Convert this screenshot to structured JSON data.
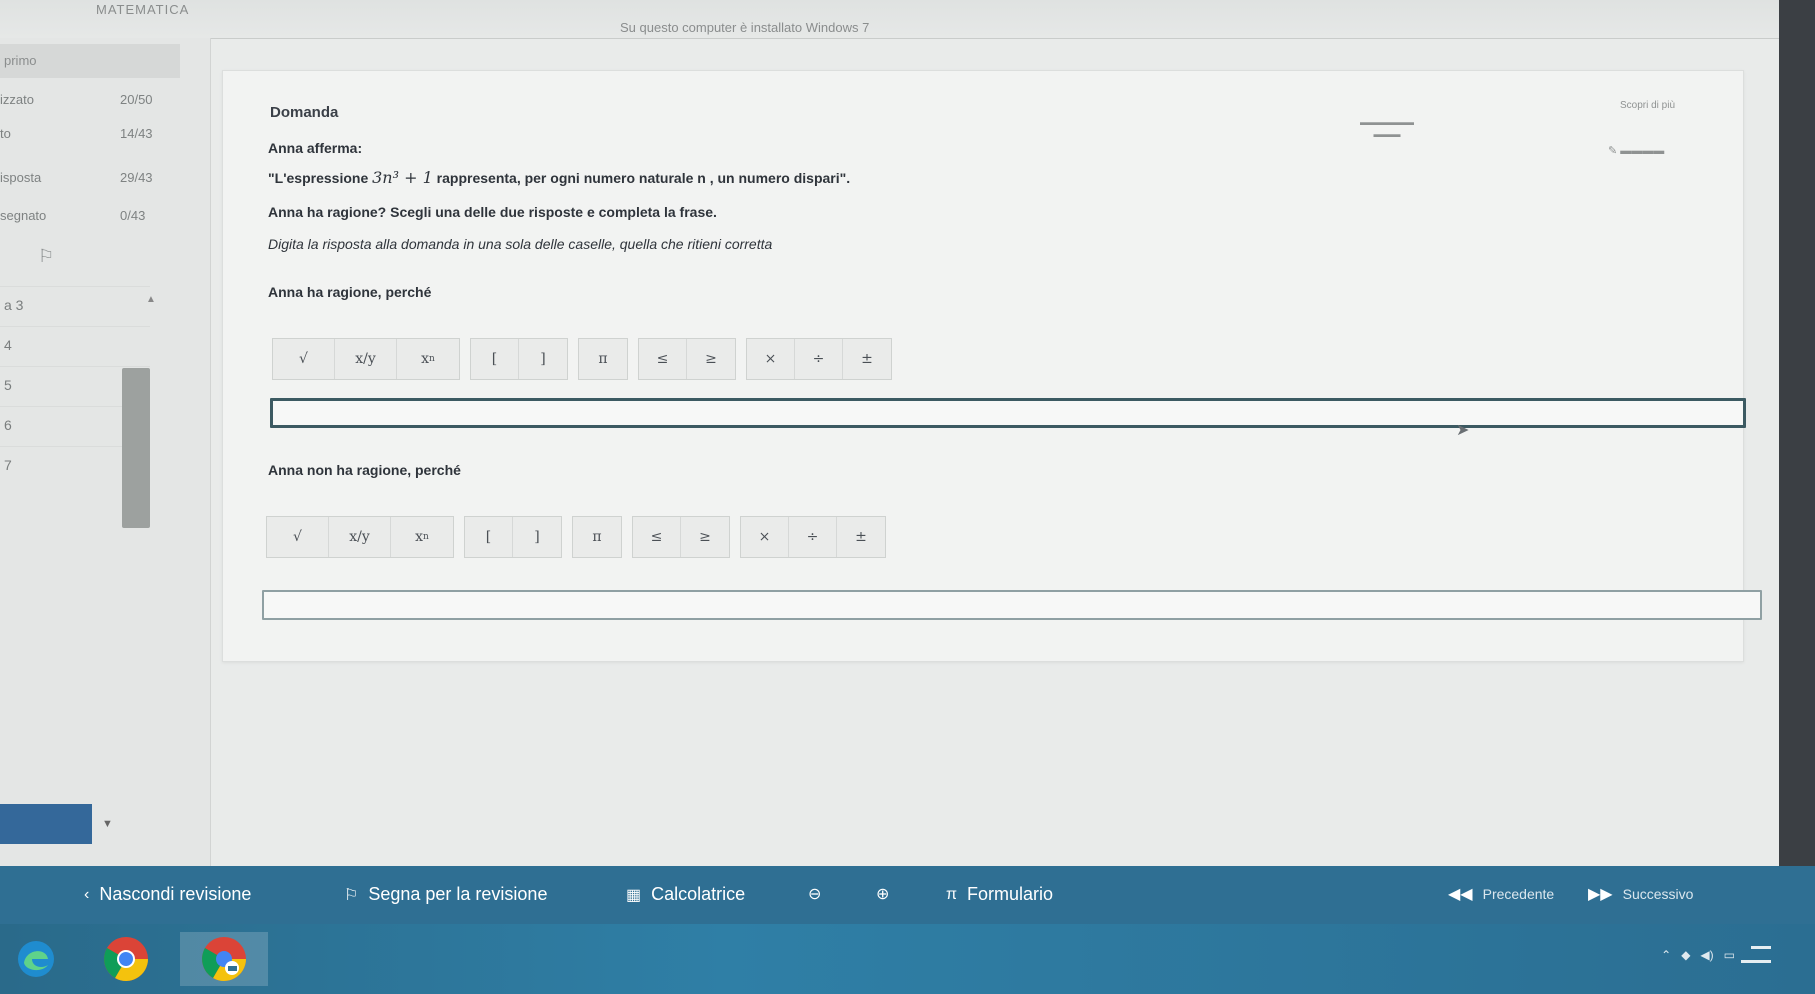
{
  "window": {
    "app_title": "MATEMATICA",
    "notice": "Su questo computer è installato Windows 7"
  },
  "left_panel": {
    "header": "primo",
    "stats": [
      {
        "label": "izzato",
        "value": "20/50"
      },
      {
        "label": "to",
        "value": "14/43"
      },
      {
        "label": "isposta",
        "value": "29/43"
      },
      {
        "label": "segnato",
        "value": "0/43"
      }
    ],
    "questions": [
      "a 3",
      "4",
      "5",
      "6",
      "7"
    ]
  },
  "header": {
    "section_title": "Domanda",
    "tools_label": "Scopri di più"
  },
  "question": {
    "intro": "Anna afferma:",
    "quote_before": "\"L'espressione",
    "expression": "3n³ + 1",
    "quote_after": "rappresenta, per ogni numero naturale n , un numero dispari\".",
    "prompt": "Anna ha ragione? Scegli una delle due risposte e completa la frase.",
    "instruction": "Digita la risposta alla domanda in una sola delle caselle, quella che ritieni corretta",
    "option_a": "Anna ha ragione, perché",
    "option_b": "Anna non ha ragione, perché"
  },
  "math_toolbar": {
    "sqrt": "√",
    "fraction": "x/y",
    "power_base": "x",
    "power_exp": "n",
    "bracket_open": "[",
    "bracket_close": "]",
    "pi": "π",
    "leq": "≤",
    "geq": "≥",
    "times": "×",
    "divide": "÷",
    "plusminus": "±"
  },
  "bottom_bar": {
    "hide_review": "Nascondi revisione",
    "mark_review": "Segna per la revisione",
    "calculator": "Calcolatrice",
    "formulary": "Formulario",
    "previous": "Precedente",
    "next": "Successivo"
  },
  "colors": {
    "bottom_bar": "#2f6f93",
    "taskbar": "#2f7fa6",
    "answer_border": "#3c5a62",
    "nav_block": "#34689a"
  }
}
